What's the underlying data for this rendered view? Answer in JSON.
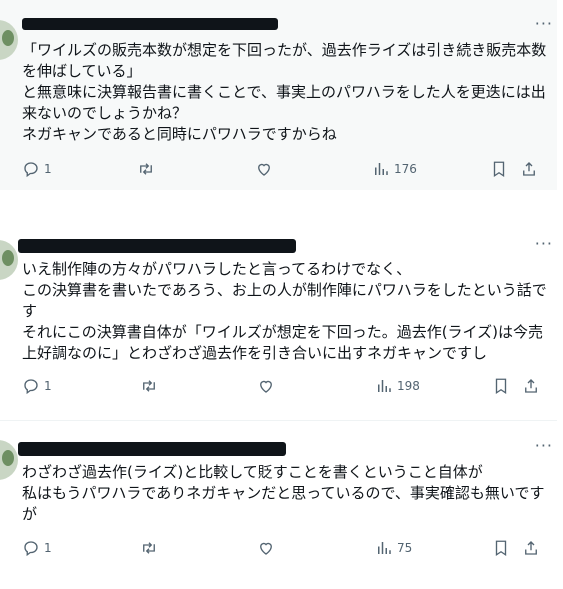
{
  "tweets": [
    {
      "text": "「ワイルズの販売本数が想定を下回ったが、過去作ライズは引き続き販売本数を伸ばしている」\nと無意味に決算報告書に書くことで、事実上のパワハラをした人を更迭には出来ないのでしょうかね？\nネガキャンであると同時にパワハラですからね",
      "replies": "1",
      "views": "176"
    },
    {
      "text": "いえ制作陣の方々がパワハラしたと言ってるわけでなく、\nこの決算書を書いたであろう、お上の人が制作陣にパワハラをしたという話です\nそれにこの決算書自体が「ワイルズが想定を下回った。過去作(ライズ)は今売上好調なのに」とわざわざ過去作を引き合いに出すネガキャンですし",
      "replies": "1",
      "views": "198"
    },
    {
      "text": "わざわざ過去作(ライズ)と比較して貶すことを書くということ自体が\n私はもうパワハラでありネガキャンだと思っているので、事実確認も無いですが",
      "replies": "1",
      "views": "75"
    }
  ],
  "icons": {
    "reply": "reply-icon",
    "retweet": "retweet-icon",
    "like": "heart-icon",
    "views": "views-icon",
    "bookmark": "bookmark-icon",
    "share": "share-icon",
    "more": "more-icon"
  },
  "colors": {
    "text": "#0f1419",
    "secondary": "#536471",
    "hover_background": "#f7f9f9",
    "divider": "#eff3f4"
  }
}
